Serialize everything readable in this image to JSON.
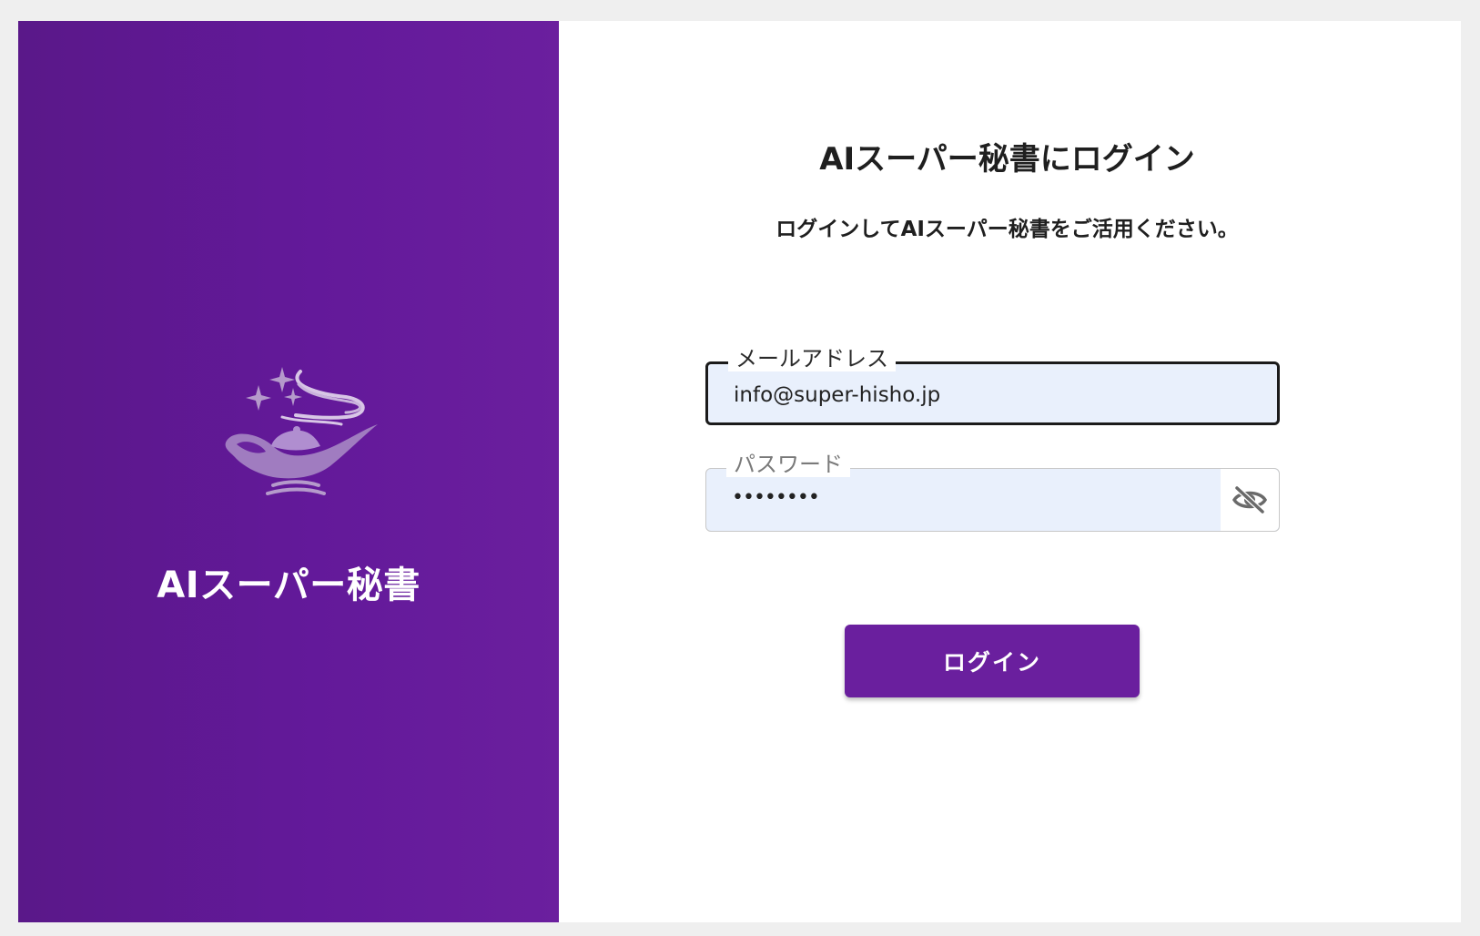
{
  "brand": {
    "title": "AIスーパー秘書",
    "logo_icon": "magic-lamp-icon",
    "panel_color": "#63199a"
  },
  "login_form": {
    "heading": "AIスーパー秘書にログイン",
    "subheading": "ログインしてAIスーパー秘書をご活用ください。",
    "email": {
      "label": "メールアドレス",
      "value": "info@super-hisho.jp"
    },
    "password": {
      "label": "パスワード",
      "masked_value": "••••••••",
      "toggle_icon": "eye-off-icon"
    },
    "submit_label": "ログイン",
    "accent_color": "#6a1f9e"
  }
}
